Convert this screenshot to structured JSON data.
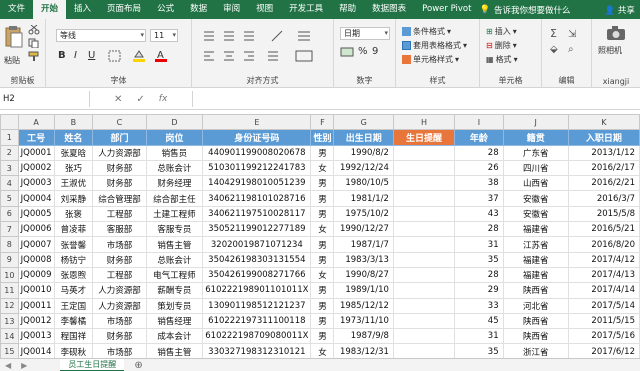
{
  "ribbon_tabs": [
    "文件",
    "开始",
    "插入",
    "页面布局",
    "公式",
    "数据",
    "审阅",
    "视图",
    "开发工具",
    "帮助",
    "数据图表",
    "Power Pivot"
  ],
  "active_tab": "开始",
  "tell_me": "告诉我你想要做什么",
  "share": "共享",
  "groups": {
    "clipboard": {
      "label": "剪贴板",
      "paste": "粘贴"
    },
    "font": {
      "label": "字体",
      "font_name": "等线",
      "font_size": "11",
      "bold": "B",
      "italic": "I",
      "underline": "U"
    },
    "alignment": {
      "label": "对齐方式"
    },
    "number": {
      "label": "数字",
      "format": "日期",
      "percent": "%"
    },
    "styles": {
      "label": "样式",
      "conditional": "条件格式",
      "table": "套用表格格式",
      "cell_styles": "单元格样式"
    },
    "cells": {
      "label": "单元格",
      "insert": "插入",
      "delete": "删除",
      "format": "格式"
    },
    "editing": {
      "label": "编辑"
    },
    "camera": {
      "label": "照相机",
      "user": "xiangji"
    }
  },
  "formula_bar": {
    "name_box": "H2",
    "fx": "fx",
    "formula": ""
  },
  "columns": [
    "A",
    "B",
    "C",
    "D",
    "E",
    "F",
    "G",
    "H",
    "I",
    "J",
    "K"
  ],
  "headers": [
    "工号",
    "姓名",
    "部门",
    "岗位",
    "身份证号码",
    "性别",
    "出生日期",
    "生日提醒",
    "年龄",
    "籍贯",
    "入职日期"
  ],
  "rows": [
    [
      "JQ0001",
      "张夏晗",
      "人力资源部",
      "销售员",
      "440901199008020678",
      "男",
      "1990/8/2",
      "",
      "28",
      "广东省",
      "2013/1/12"
    ],
    [
      "JQ0002",
      "张巧",
      "财务部",
      "总账会计",
      "510301199212241783",
      "女",
      "1992/12/24",
      "",
      "26",
      "四川省",
      "2016/2/17"
    ],
    [
      "JQ0003",
      "王淑优",
      "财务部",
      "财务经理",
      "140429198010051239",
      "男",
      "1980/10/5",
      "",
      "38",
      "山西省",
      "2016/2/21"
    ],
    [
      "JQ0004",
      "刘采静",
      "综合管理部",
      "综合部主任",
      "340621198101028716",
      "男",
      "1981/1/2",
      "",
      "37",
      "安徽省",
      "2016/3/7"
    ],
    [
      "JQ0005",
      "张褒",
      "工程部",
      "土建工程师",
      "340621197510028117",
      "男",
      "1975/10/2",
      "",
      "43",
      "安徽省",
      "2015/5/8"
    ],
    [
      "JQ0006",
      "曾凌菲",
      "客服部",
      "客服专员",
      "350521199012277189",
      "女",
      "1990/12/27",
      "",
      "28",
      "福建省",
      "2016/5/21"
    ],
    [
      "JQ0007",
      "张誉馨",
      "市场部",
      "销售主管",
      "32020019871071234",
      "男",
      "1987/1/7",
      "",
      "31",
      "江苏省",
      "2016/8/20"
    ],
    [
      "JQ0008",
      "杨钫宁",
      "财务部",
      "总账会计",
      "350426198303131554",
      "男",
      "1983/3/13",
      "",
      "35",
      "福建省",
      "2017/4/12"
    ],
    [
      "JQ0009",
      "张恩煦",
      "工程部",
      "电气工程师",
      "350426199008271766",
      "女",
      "1990/8/27",
      "",
      "28",
      "福建省",
      "2017/4/13"
    ],
    [
      "JQ0010",
      "马英才",
      "人力资源部",
      "薪酬专员",
      "610222198901101011X",
      "男",
      "1989/1/10",
      "",
      "29",
      "陕西省",
      "2017/4/14"
    ],
    [
      "JQ0011",
      "王定国",
      "人力资源部",
      "策划专员",
      "130901198512121237",
      "男",
      "1985/12/12",
      "",
      "33",
      "河北省",
      "2017/5/14"
    ],
    [
      "JQ0012",
      "李馨橘",
      "市场部",
      "销售经理",
      "610222197311100118",
      "男",
      "1973/11/10",
      "",
      "45",
      "陕西省",
      "2011/5/15"
    ],
    [
      "JQ0013",
      "程国祥",
      "财务部",
      "成本会计",
      "610222198709080011X",
      "男",
      "1987/9/8",
      "",
      "31",
      "陕西省",
      "2017/5/16"
    ],
    [
      "JQ0014",
      "李砚秋",
      "市场部",
      "销售主管",
      "330327198312310121",
      "女",
      "1983/12/31",
      "",
      "35",
      "浙江省",
      "2017/6/12"
    ]
  ],
  "sheet_tab": "员工生日提醒",
  "colors": {
    "excel_green": "#217346",
    "header_blue": "#5b9bd5",
    "highlight_orange": "#e8753a"
  }
}
